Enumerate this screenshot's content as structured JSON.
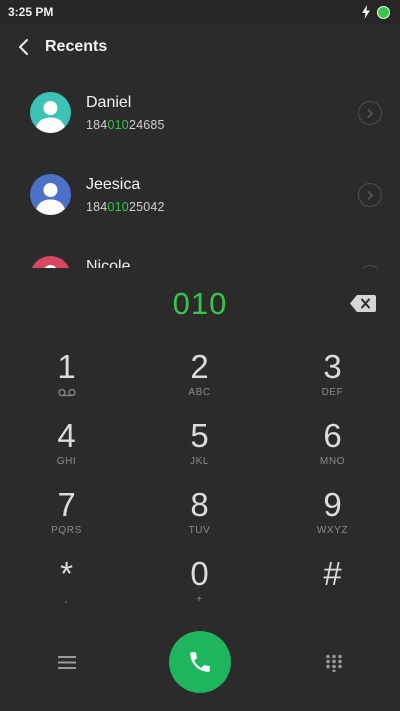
{
  "status_bar": {
    "time": "3:25 PM",
    "icons": [
      "charging-bolt-icon",
      "battery-icon"
    ],
    "battery_color": "#35c64b"
  },
  "header": {
    "title": "Recents",
    "back_icon": "chevron-left-icon"
  },
  "recents": [
    {
      "name": "Daniel",
      "number_prefix": "184",
      "number_match": "010",
      "number_suffix": "24685",
      "avatar_color": "#3cc3b5"
    },
    {
      "name": "Jeesica",
      "number_prefix": "184",
      "number_match": "010",
      "number_suffix": "25042",
      "avatar_color": "#4c72c8"
    },
    {
      "name": "Nicole",
      "avatar_color": "#d9465f"
    }
  ],
  "dialer": {
    "input": "010",
    "input_color": "#35c64b",
    "keys": [
      {
        "digit": "1",
        "letters": ""
      },
      {
        "digit": "2",
        "letters": "ABC"
      },
      {
        "digit": "3",
        "letters": "DEF"
      },
      {
        "digit": "4",
        "letters": "GHI"
      },
      {
        "digit": "5",
        "letters": "JKL"
      },
      {
        "digit": "6",
        "letters": "MNO"
      },
      {
        "digit": "7",
        "letters": "PQRS"
      },
      {
        "digit": "8",
        "letters": "TUV"
      },
      {
        "digit": "9",
        "letters": "WXYZ"
      },
      {
        "digit": "*",
        "letters": ","
      },
      {
        "digit": "0",
        "letters": "+"
      },
      {
        "digit": "#",
        "letters": ""
      }
    ]
  },
  "bottom_bar": {
    "icons": [
      "menu-icon",
      "phone-icon",
      "dialpad-icon"
    ],
    "call_color": "#1fb55e"
  }
}
